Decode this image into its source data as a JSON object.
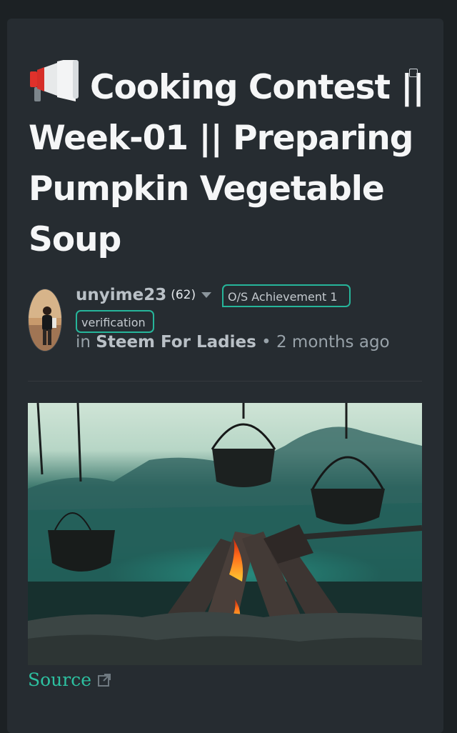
{
  "post": {
    "title_icon": "megaphone-icon",
    "title": "Cooking Contest || Week-01 || Preparing Pumpkin Vegetable Soup",
    "author": "unyime23",
    "reputation": "(62)",
    "tags": [
      "O/S Achievement 1",
      "verification"
    ],
    "in_label": "in",
    "community": "Steem For Ladies",
    "separator": "•",
    "time_ago": "2 months ago",
    "image_icon": "campfire-cooking-pots-image",
    "source_label": "Source",
    "source_icon": "external-link-icon"
  },
  "colors": {
    "background": "#1c2124",
    "card": "#262c31",
    "accent": "#26b59a",
    "title_text": "#f5f6f7"
  }
}
